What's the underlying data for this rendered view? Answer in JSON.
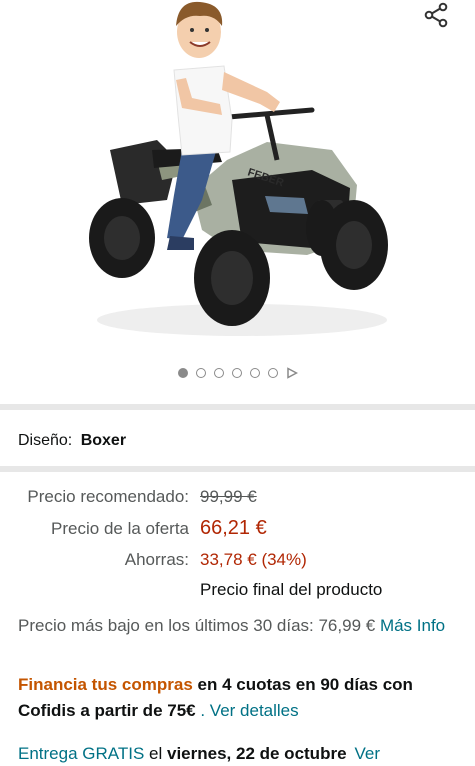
{
  "gallery": {
    "image_alt": "Niño en quad eléctrico",
    "dot_count": 6,
    "active_dot": 0,
    "vehicle_badge": "FEBER"
  },
  "variant": {
    "label": "Diseño:",
    "value": "Boxer"
  },
  "price": {
    "list_label": "Precio recomendado:",
    "list_value": "99,99 €",
    "deal_label": "Precio de la oferta",
    "deal_value": "66,21 €",
    "savings_label": "Ahorras:",
    "savings_value": "33,78 € (34%)",
    "final_note": "Precio final del producto"
  },
  "lowest_price": {
    "text": "Precio más bajo en los últimos 30 días: 76,99 €",
    "link": "Más Info"
  },
  "finance": {
    "highlight": "Financia tus compras",
    "text": "en 4 cuotas en 90 días con Cofidis a partir de 75€",
    "link": ". Ver detalles"
  },
  "delivery": {
    "link": "Entrega GRATIS",
    "text_pre": "el",
    "date": "viernes, 22 de octubre",
    "link2": "Ver"
  },
  "colors": {
    "price_red": "#b12704",
    "link_teal": "#007185",
    "finance_orange": "#c45500"
  }
}
